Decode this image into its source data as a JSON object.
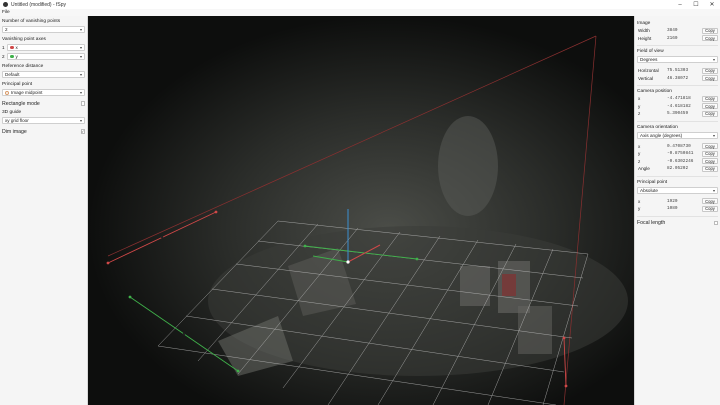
{
  "window": {
    "title": "Untitled (modified) - fSpy",
    "minimize": "–",
    "maximize": "☐",
    "close": "✕"
  },
  "menu": {
    "file": "File"
  },
  "left_panel": {
    "vp_count_label": "Number of vanishing points",
    "vp_count_value": "2",
    "vp_axes_label": "Vanishing point axes",
    "axis1_num": "1",
    "axis1_value": "x",
    "axis2_num": "2",
    "axis2_value": "y",
    "ref_distance_label": "Reference distance",
    "ref_distance_value": "Default",
    "principal_point_label": "Principal point",
    "principal_point_value": "Image midpoint",
    "rectangle_mode_label": "Rectangle mode",
    "guide_label": "3D guide",
    "guide_value": "xy grid floor",
    "dim_image_label": "Dim image",
    "checkmark": "✓"
  },
  "right_panel": {
    "copy": "Copy",
    "image_title": "Image",
    "width_label": "Width",
    "width_value": "3840",
    "height_label": "Height",
    "height_value": "2160",
    "fov_title": "Field of view",
    "fov_unit": "Degrees",
    "horizontal_label": "Horizontal",
    "horizontal_value": "75.51303",
    "vertical_label": "Vertical",
    "vertical_value": "46.38072",
    "cam_pos_title": "Camera position",
    "pos_x_label": "x",
    "pos_x_value": "-4.471818",
    "pos_y_label": "y",
    "pos_y_value": "-4.618182",
    "pos_z_label": "z",
    "pos_z_value": "5.390459",
    "cam_orient_title": "Camera orientation",
    "orient_mode": "Axis angle (degrees)",
    "or_x_label": "x",
    "or_x_value": "0.4708730",
    "or_y_label": "y",
    "or_y_value": "-0.8750841",
    "or_z_label": "z",
    "or_z_value": "-0.6302246",
    "angle_label": "Angle",
    "angle_value": "82.05202",
    "pp_title": "Principal point",
    "pp_mode": "Absolute",
    "pp_x_label": "x",
    "pp_x_value": "1920",
    "pp_y_label": "y",
    "pp_y_value": "1080",
    "focal_label": "Focal length"
  },
  "colors": {
    "axis_x": "#d04848",
    "axis_y": "#3fb04a",
    "axis_z": "#3a8fd0",
    "ring": "#d79a6a"
  }
}
